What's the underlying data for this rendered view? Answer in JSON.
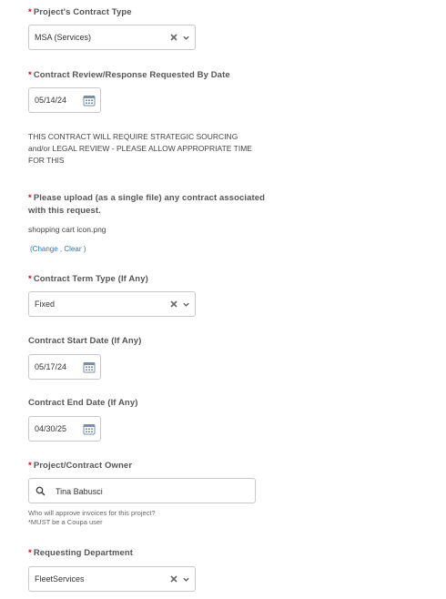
{
  "contract_type": {
    "required_mark": "*",
    "label": "Project's Contract Type",
    "value": "MSA (Services)"
  },
  "review_date": {
    "required_mark": "*",
    "label": "Contract Review/Response Requested By Date",
    "value": "05/14/24"
  },
  "notice": {
    "line1": "THIS CONTRACT WILL REQUIRE STRATEGIC SOURCING",
    "line2": "and/or LEGAL REVIEW - PLEASE ALLOW APPROPRIATE TIME",
    "line3": "FOR THIS"
  },
  "upload": {
    "required_mark": "*",
    "label_line1": "Please upload (as a single file) any contract associated",
    "label_line2": "with this request.",
    "file_name": "shopping cart icon.png",
    "open_paren": "(",
    "change_link": "Change",
    "separator": " , ",
    "clear_link": "Clear",
    "close_paren": " )"
  },
  "term_type": {
    "required_mark": "*",
    "label": "Contract Term Type (If Any)",
    "value": "Fixed"
  },
  "start_date": {
    "label": "Contract Start Date (If Any)",
    "value": "05/17/24"
  },
  "end_date": {
    "label": "Contract End Date (If Any)",
    "value": "04/30/25"
  },
  "owner": {
    "required_mark": "*",
    "label": "Project/Contract Owner",
    "value": "Tina Babusci",
    "help_line1": "Who will approve invoices for this project?",
    "help_line2": "*MUST be a Coupa user"
  },
  "department": {
    "required_mark": "*",
    "label": "Requesting Department",
    "value": "FleetServices"
  }
}
